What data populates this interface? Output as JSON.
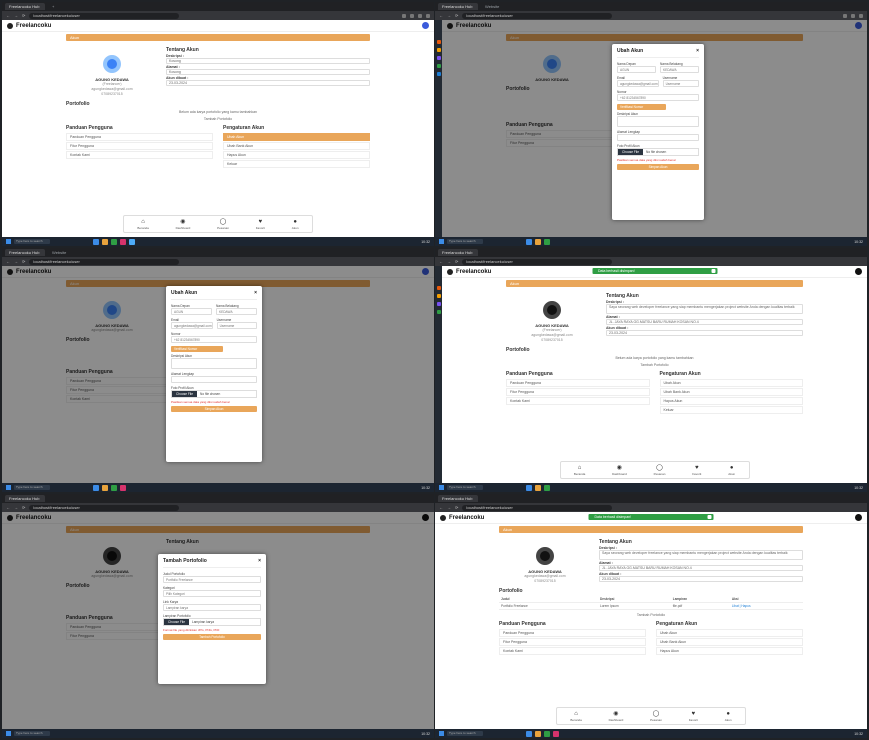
{
  "browser": {
    "tab_title": "Freelancoku Hub",
    "tab2_title": "Website",
    "url": "localhost/freelanceku/user"
  },
  "app": {
    "brand": "Freelancoku",
    "banner": "Akun"
  },
  "profile_a": {
    "name": "AGUNG KEDAWA",
    "sub": "(Freelancer)",
    "email": "agungkedawa@gmail.com",
    "phone": "07089237015",
    "since": "Untuk bagian data Portofolio"
  },
  "about": {
    "title": "Tentang Akun",
    "desc_label": "Deskripsi :",
    "desc_value": "Kosong",
    "address_label": "Alamat :",
    "address_value": "Kosong",
    "joined_label": "Akun dibuat :",
    "joined_value": "23-03-2024",
    "desc_long": "Saya seorang web developer freelance yang siap membantu mengerjakan project website Anda dengan kualitas terbaik",
    "address_long": "JL. JAYA RAYA GG.MATSU BARU RUMAH KOSAN NO.4"
  },
  "portfolio": {
    "title": "Portofolio",
    "empty": "Belum ada karya portofolio yang kamu tambahkan",
    "add_link": "Tambah Portofolio",
    "headers": [
      "Judul",
      "Deskripsi",
      "Lampiran",
      "Aksi"
    ],
    "row": [
      "Portfolio Freelance",
      "Lorem Ipsum",
      "file.pdf",
      "Lihat | Hapus"
    ]
  },
  "guide": {
    "title": "Panduan Pengguna",
    "items": [
      "Panduan Pengguna",
      "Fitur Pengguna",
      "Kontak Kami"
    ]
  },
  "settings": {
    "title": "Pengaturan Akun",
    "items": [
      "Ubah Akun",
      "Ubah Bank Akun",
      "Hapus Akun",
      "Keluar"
    ]
  },
  "bottom_nav": [
    {
      "icon": "⌂",
      "label": "Beranda"
    },
    {
      "icon": "◉",
      "label": "Dashboard"
    },
    {
      "icon": "◯",
      "label": "Pesanan"
    },
    {
      "icon": "♥",
      "label": "Favorit"
    },
    {
      "icon": "●",
      "label": "Akun"
    }
  ],
  "edit_modal": {
    "title": "Ubah Akun",
    "first_name_label": "Nama Depan",
    "first_name": "AGUN",
    "last_name_label": "Nama Belakang",
    "last_name": "KEDAWA",
    "email_label": "Email",
    "email": "agungkedawa@gmail.com",
    "username_label": "Username",
    "username": "Username",
    "phone_label": "Nomor",
    "phone_prefix": "+62",
    "phone": "81234567890",
    "verify_btn": "Verifikasi Nomor",
    "desc_label": "Deskripsi Akun",
    "address_label": "Alamat Lengkap",
    "photo_label": "Foto Profil Akun",
    "choose_file": "Choose File",
    "no_file": "No file chosen",
    "note": "Pastikan semua data yang diisi sudah benar",
    "save": "Simpan Akun"
  },
  "portfolio_modal": {
    "title": "Tambah Portofolio",
    "name_label": "Judul Portofolio",
    "name_value": "Portfolio Freelance",
    "cat_label": "Kategori",
    "cat_value": "Pilih Kategori",
    "link_label": "Link Karya",
    "link_value": "Lampiran karya",
    "file_label": "Lampiran Portofolio",
    "choose_file": "Choose File",
    "file_name": "Lampiran karya",
    "note": "Format file yang diizinkan JPG, PNG, PDF",
    "save": "Tambah Portofolio"
  },
  "toast": "Data berhasil disimpan!",
  "taskbar": {
    "search": "Type here to search",
    "clock": "10:32"
  }
}
